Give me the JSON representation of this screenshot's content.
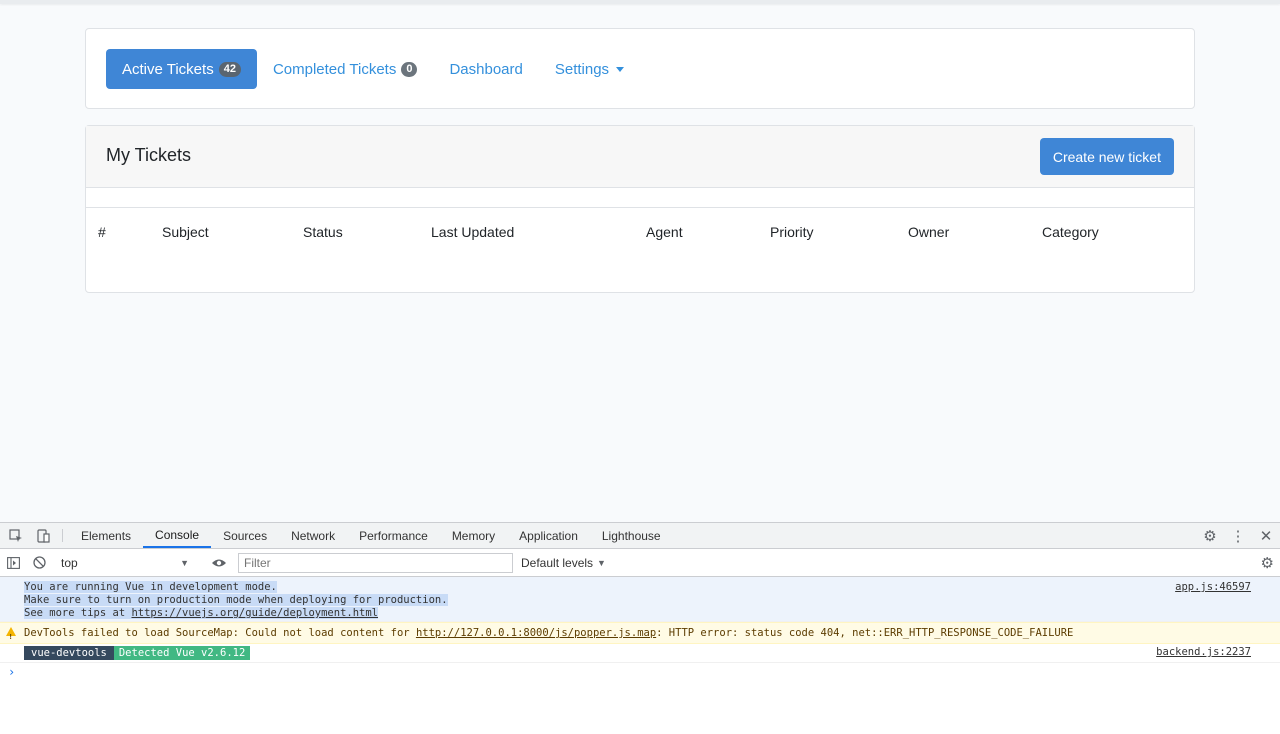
{
  "nav": {
    "items": [
      {
        "label": "Active Tickets",
        "badge": "42",
        "active": true
      },
      {
        "label": "Completed Tickets",
        "badge": "0",
        "active": false
      },
      {
        "label": "Dashboard"
      },
      {
        "label": "Settings"
      }
    ]
  },
  "tickets": {
    "title": "My Tickets",
    "create_label": "Create new ticket",
    "columns": [
      "#",
      "Subject",
      "Status",
      "Last Updated",
      "Agent",
      "Priority",
      "Owner",
      "Category"
    ]
  },
  "devtools": {
    "tabs": [
      "Elements",
      "Console",
      "Sources",
      "Network",
      "Performance",
      "Memory",
      "Application",
      "Lighthouse"
    ],
    "active_tab": "Console",
    "context": "top",
    "filter_placeholder": "Filter",
    "levels_label": "Default levels",
    "messages": {
      "info_lines": [
        "You are running Vue in development mode.",
        "Make sure to turn on production mode when deploying for production.",
        "See more tips at "
      ],
      "info_link": "https://vuejs.org/guide/deployment.html",
      "info_source": "app.js:46597",
      "warn_prefix": "DevTools failed to load SourceMap: Could not load content for ",
      "warn_link": "http://127.0.0.1:8000/js/popper.js.map",
      "warn_suffix": ": HTTP error: status code 404, net::ERR_HTTP_RESPONSE_CODE_FAILURE",
      "vue_tag": "vue-devtools",
      "vue_detected": "Detected Vue v2.6.12",
      "vue_source": "backend.js:2237"
    },
    "prompt": "›"
  },
  "colors": {
    "primary": "#3f86d6",
    "link": "#3490dc",
    "badge": "#6c757d"
  }
}
